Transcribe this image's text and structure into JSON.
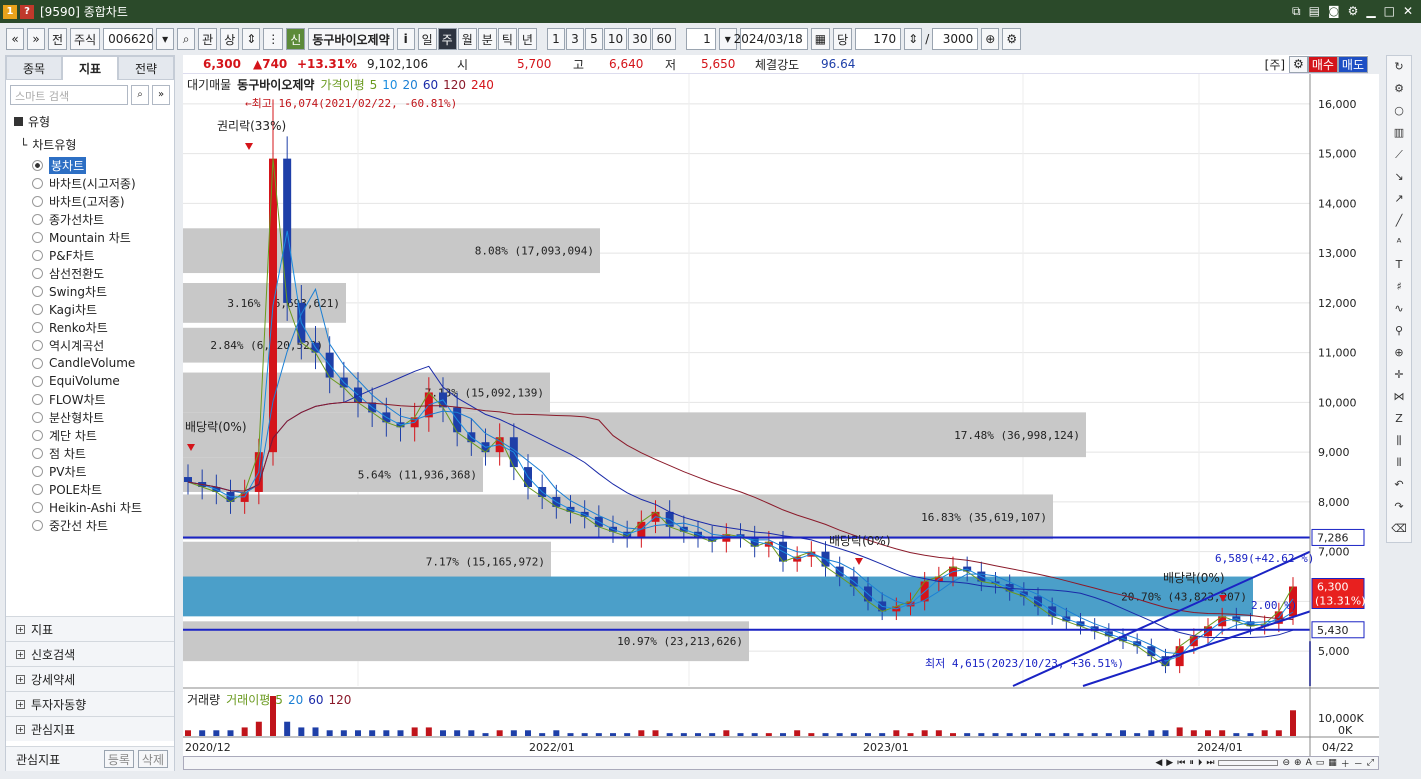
{
  "window": {
    "badge1": "1",
    "badge2": "?",
    "title": "[9590] 종합차트"
  },
  "toolbar": {
    "nav_prev": "«",
    "nav_down": "»",
    "prev_label": "전",
    "market": "주식",
    "code": "006620",
    "search": "⌕",
    "rel": "관",
    "adj": "상",
    "new_badge": "신",
    "stock_name": "동구바이오제약",
    "info": "i",
    "periods": [
      "일",
      "주",
      "월",
      "분",
      "틱",
      "년"
    ],
    "active_period": "주",
    "minutes": [
      "1",
      "3",
      "5",
      "10",
      "30",
      "60"
    ],
    "count1": "1",
    "date": "2024/03/18",
    "unit": "당",
    "count2": "170",
    "count_max": "3000"
  },
  "left": {
    "tabs": [
      "종목",
      "지표",
      "전략"
    ],
    "active_tab": "지표",
    "search_placeholder": "스마트 검색",
    "section": "유형",
    "chart_type_label": "차트유형",
    "chart_types": [
      "봉차트",
      "바차트(시고저종)",
      "바차트(고저종)",
      "종가선차트",
      "Mountain 차트",
      "P&F차트",
      "삼선전환도",
      "Swing차트",
      "Kagi차트",
      "Renko차트",
      "역시계곡선",
      "CandleVolume",
      "EquiVolume",
      "FLOW차트",
      "분산형차트",
      "계단 차트",
      "점 차트",
      "PV차트",
      "POLE차트",
      "Heikin-Ashi 차트",
      "중간선 차트"
    ],
    "selected_type": "봉차트",
    "groups": [
      "지표",
      "신호검색",
      "강세약세",
      "투자자동향",
      "관심지표"
    ],
    "footer_label": "관심지표",
    "register": "등록",
    "delete": "삭제"
  },
  "price": {
    "current": "6,300",
    "change": "▲740",
    "rate": "+13.31%",
    "volume": "9,102,106",
    "open_label": "시",
    "open": "5,700",
    "high_label": "고",
    "high": "6,640",
    "low_label": "저",
    "low": "5,650",
    "strength_label": "체결강도",
    "strength": "96.64",
    "type_tag": "[주]",
    "buy": "매수",
    "sell": "매도"
  },
  "chart": {
    "legend": {
      "title": "대기매물",
      "name": "동구바이오제약",
      "ma_label": "가격이평",
      "ma": [
        "5",
        "10",
        "20",
        "60",
        "120",
        "240"
      ],
      "ma_colors": [
        "#6a9a1f",
        "#1b8de0",
        "#1b7fd4",
        "#1a2aa8",
        "#8b1a2a",
        "#d4141a"
      ]
    },
    "high_note": "←최고 16,074(2021/02/22, -60.81%)",
    "low_note": "최저 4,615(2023/10/23, +36.51%)",
    "events": [
      {
        "text": "권리락(33%)"
      },
      {
        "text": "배당락(0%)"
      },
      {
        "text": "배당락(0%)"
      },
      {
        "text": "배당락(0%)"
      }
    ],
    "target_up": "6,589(+42.62 %)",
    "target_mid": "2.00 %)",
    "volume_bands": [
      {
        "label": "8.08% (17,093,094)"
      },
      {
        "label": "3.16% (6,693,621)"
      },
      {
        "label": "2.84% (6,020,523)"
      },
      {
        "label": "7.13% (15,092,139)"
      },
      {
        "label": "17.48% (36,998,124)"
      },
      {
        "label": "5.64% (11,936,368)"
      },
      {
        "label": "16.83% (35,619,107)"
      },
      {
        "label": "7.17% (15,165,972)"
      },
      {
        "label": "20.70% (43,823,207)"
      },
      {
        "label": "10.97% (23,213,626)"
      }
    ],
    "y_ticks": [
      "16,000",
      "15,000",
      "14,000",
      "13,000",
      "12,000",
      "11,000",
      "10,000",
      "9,000",
      "8,000",
      "7,000",
      "6,000",
      "5,000"
    ],
    "tag_upper": "7,286",
    "tag_current": "6,300",
    "tag_current_rate": "(13.31%)",
    "tag_lower": "5,430",
    "volume_legend": {
      "title": "거래량",
      "ma_label": "거래이평",
      "ma": [
        "5",
        "20",
        "60",
        "120"
      ]
    },
    "vol_ticks": [
      "10,000K",
      "0K"
    ],
    "x_labels": [
      "2020/12",
      "2022/01",
      "2023/01",
      "2024/01"
    ],
    "x_right": "04/22"
  },
  "chart_data": {
    "type": "candlestick",
    "title": "동구바이오제약",
    "period": "주",
    "ohlc_last": {
      "open": 5700,
      "high": 6640,
      "low": 5650,
      "close": 6300
    },
    "all_time_high": 16074,
    "all_time_low": 4615,
    "price_range": [
      4300,
      16400
    ],
    "closes": [
      8400,
      8300,
      8200,
      8000,
      8200,
      9000,
      14900,
      12000,
      11200,
      11000,
      10500,
      10300,
      10000,
      9800,
      9600,
      9500,
      9700,
      10200,
      9900,
      9400,
      9200,
      9000,
      9300,
      8700,
      8300,
      8100,
      7900,
      7800,
      7700,
      7500,
      7400,
      7300,
      7600,
      7800,
      7500,
      7400,
      7300,
      7200,
      7350,
      7300,
      7100,
      7200,
      6800,
      6900,
      7000,
      6700,
      6500,
      6300,
      6000,
      5800,
      5900,
      6000,
      6400,
      6500,
      6700,
      6600,
      6400,
      6350,
      6200,
      6100,
      5900,
      5700,
      5600,
      5500,
      5400,
      5300,
      5200,
      5100,
      4900,
      4700,
      5100,
      5300,
      5500,
      5700,
      5600,
      5500,
      5550,
      5800,
      6300
    ],
    "volumes": [
      2,
      2,
      2,
      2,
      3,
      5,
      14,
      5,
      3,
      3,
      2,
      2,
      2,
      2,
      2,
      2,
      3,
      3,
      2,
      2,
      2,
      1,
      2,
      2,
      2,
      1,
      2,
      1,
      1,
      1,
      1,
      1,
      2,
      2,
      1,
      1,
      1,
      1,
      2,
      1,
      1,
      1,
      1,
      2,
      1,
      1,
      1,
      1,
      1,
      1,
      2,
      1,
      2,
      2,
      1,
      1,
      1,
      1,
      1,
      1,
      1,
      1,
      1,
      1,
      1,
      1,
      2,
      1,
      2,
      2,
      3,
      2,
      2,
      2,
      1,
      1,
      2,
      2,
      9
    ]
  }
}
